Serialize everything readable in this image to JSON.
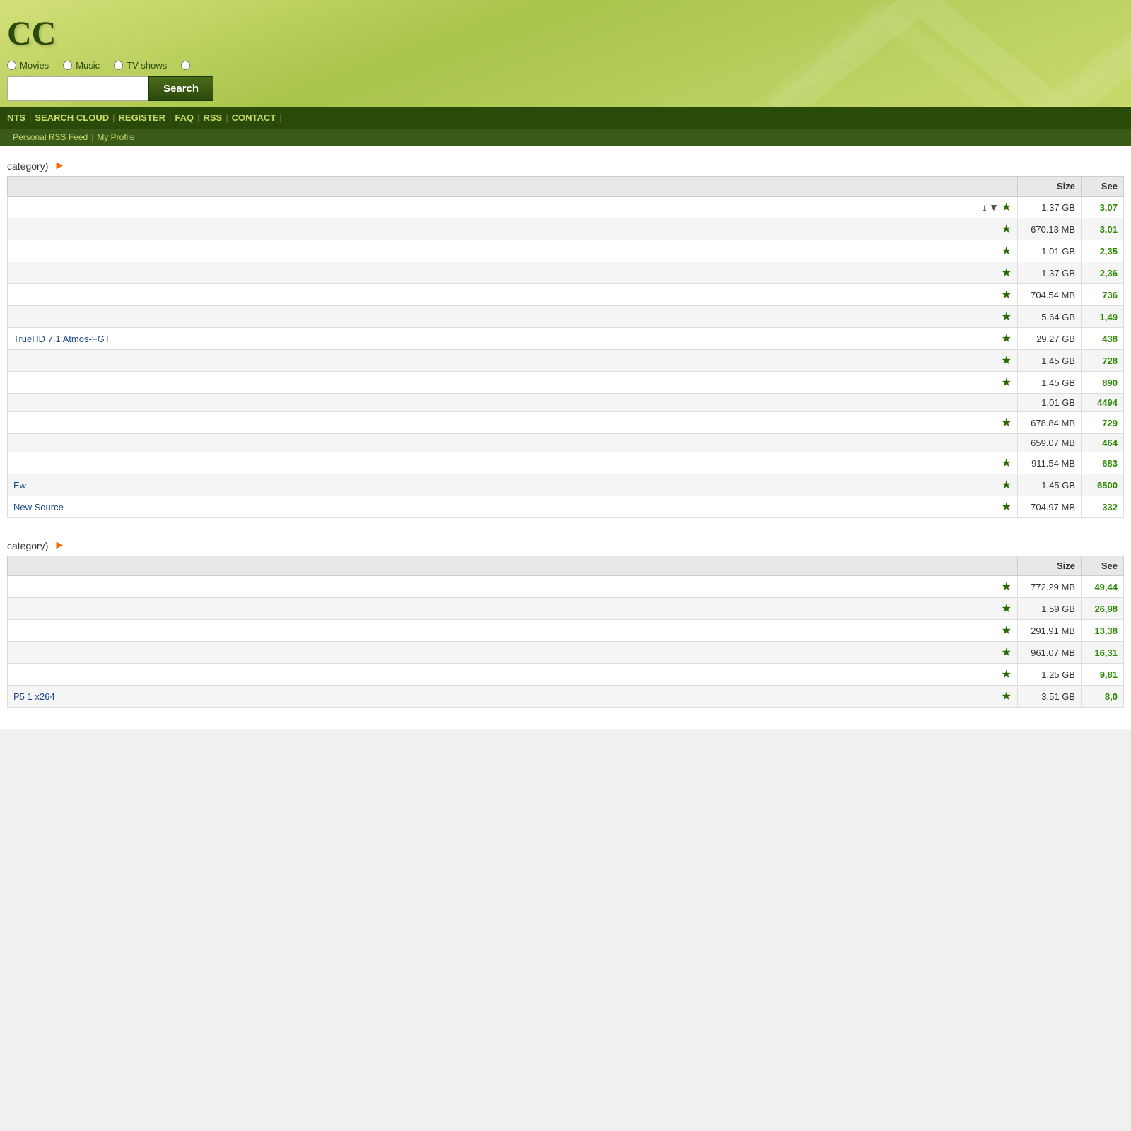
{
  "header": {
    "logo": "CC",
    "tabs": [
      {
        "label": "Movies",
        "value": "movies"
      },
      {
        "label": "Music",
        "value": "music"
      },
      {
        "label": "TV shows",
        "value": "tvshows"
      },
      {
        "label": "",
        "value": "other"
      }
    ],
    "search_placeholder": "",
    "search_label": "Search"
  },
  "main_nav": {
    "items": [
      {
        "label": "NTS",
        "separator": true
      },
      {
        "label": "SEARCH CLOUD",
        "separator": true
      },
      {
        "label": "REGISTER",
        "separator": true
      },
      {
        "label": "FAQ",
        "separator": true
      },
      {
        "label": "RSS",
        "separator": true
      },
      {
        "label": "CONTACT",
        "separator": true
      }
    ]
  },
  "sub_nav": {
    "items": [
      {
        "label": "Personal RSS Feed",
        "separator": true
      },
      {
        "label": "My Profile",
        "separator": false
      }
    ]
  },
  "section1": {
    "category": "category)",
    "columns": [
      "",
      "",
      "Size",
      "See"
    ],
    "rows": [
      {
        "name": "",
        "size": "1.37 GB",
        "seeds": "3,07",
        "has_star": true,
        "has_comment": true,
        "comment_num": "1"
      },
      {
        "name": "",
        "size": "670.13 MB",
        "seeds": "3,01",
        "has_star": true,
        "has_comment": false,
        "comment_num": ""
      },
      {
        "name": "",
        "size": "1.01 GB",
        "seeds": "2,35",
        "has_star": true,
        "has_comment": false,
        "comment_num": ""
      },
      {
        "name": "",
        "size": "1.37 GB",
        "seeds": "2,36",
        "has_star": true,
        "has_comment": false,
        "comment_num": ""
      },
      {
        "name": "",
        "size": "704.54 MB",
        "seeds": "736",
        "has_star": true,
        "has_comment": false,
        "comment_num": ""
      },
      {
        "name": "",
        "size": "5.64 GB",
        "seeds": "1,49",
        "has_star": true,
        "has_comment": false,
        "comment_num": ""
      },
      {
        "name": "TrueHD 7.1 Atmos-FGT",
        "size": "29.27 GB",
        "seeds": "438",
        "has_star": true,
        "has_comment": false,
        "comment_num": ""
      },
      {
        "name": "",
        "size": "1.45 GB",
        "seeds": "728",
        "has_star": true,
        "has_comment": false,
        "comment_num": ""
      },
      {
        "name": "",
        "size": "1.45 GB",
        "seeds": "890",
        "has_star": true,
        "has_comment": false,
        "comment_num": ""
      },
      {
        "name": "",
        "size": "1.01 GB",
        "seeds": "4494",
        "has_star": false,
        "has_comment": false,
        "comment_num": ""
      },
      {
        "name": "",
        "size": "678.84 MB",
        "seeds": "729",
        "has_star": true,
        "has_comment": false,
        "comment_num": ""
      },
      {
        "name": "",
        "size": "659.07 MB",
        "seeds": "464",
        "has_star": false,
        "has_comment": false,
        "comment_num": ""
      },
      {
        "name": "",
        "size": "911.54 MB",
        "seeds": "683",
        "has_star": true,
        "has_comment": false,
        "comment_num": ""
      },
      {
        "name": "Ew",
        "size": "1.45 GB",
        "seeds": "6500",
        "has_star": true,
        "has_comment": false,
        "comment_num": ""
      },
      {
        "name": "New Source",
        "size": "704.97 MB",
        "seeds": "332",
        "has_star": true,
        "has_comment": false,
        "comment_num": ""
      }
    ]
  },
  "section2": {
    "category": "category)",
    "columns": [
      "",
      "",
      "Size",
      "See"
    ],
    "rows": [
      {
        "name": "",
        "size": "772.29 MB",
        "seeds": "49,44",
        "has_star": true,
        "has_comment": false,
        "comment_num": ""
      },
      {
        "name": "",
        "size": "1.59 GB",
        "seeds": "26,98",
        "has_star": true,
        "has_comment": false,
        "comment_num": ""
      },
      {
        "name": "",
        "size": "291.91 MB",
        "seeds": "13,38",
        "has_star": true,
        "has_comment": false,
        "comment_num": ""
      },
      {
        "name": "",
        "size": "961.07 MB",
        "seeds": "16,31",
        "has_star": true,
        "has_comment": false,
        "comment_num": ""
      },
      {
        "name": "",
        "size": "1.25 GB",
        "seeds": "9,81",
        "has_star": true,
        "has_comment": false,
        "comment_num": ""
      },
      {
        "name": "P5 1 x264",
        "size": "3.51 GB",
        "seeds": "8,0",
        "has_star": true,
        "has_comment": false,
        "comment_num": ""
      }
    ]
  }
}
